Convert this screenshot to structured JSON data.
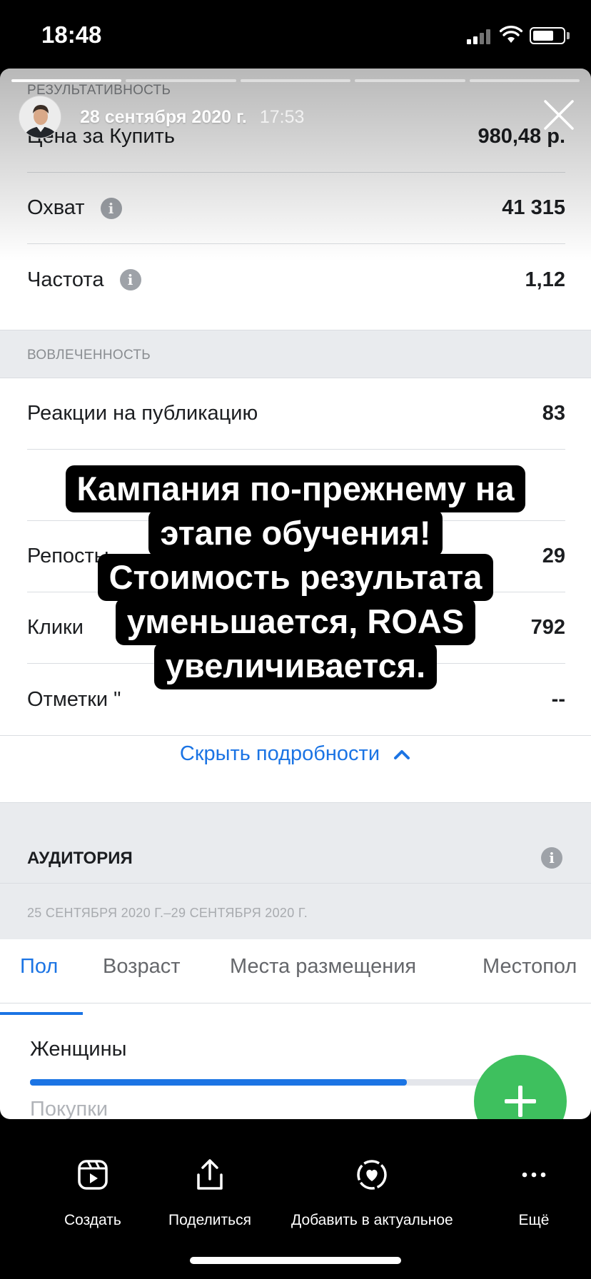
{
  "status_bar": {
    "time": "18:48"
  },
  "story": {
    "date": "28 сентября 2020 г.",
    "time": "17:53"
  },
  "results": {
    "section_label": "РЕЗУЛЬТАТИВНОСТЬ",
    "rows": [
      {
        "label": "Цена за Купить",
        "value": "980,48 р."
      },
      {
        "label": "Охват",
        "value": "41 315"
      },
      {
        "label": "Частота",
        "value": "1,12"
      }
    ]
  },
  "engagement": {
    "section_label": "ВОВЛЕЧЕННОСТЬ",
    "rows": [
      {
        "label": "Реакции на публикацию",
        "value": "83"
      },
      {
        "label": "Репосты",
        "value": "29"
      },
      {
        "label": "Клики",
        "value": "792"
      },
      {
        "label": "Отметки \"",
        "value": "--"
      }
    ]
  },
  "caption": {
    "lines": [
      "Кампания по-прежнему на",
      "этапе обучения!",
      "Стоимость результата",
      "уменьшается, ROAS",
      "увеличивается."
    ]
  },
  "hide_details": {
    "label": "Скрыть подробности",
    "icon": "chevron-up-icon"
  },
  "audience": {
    "title": "АУДИТОРИЯ",
    "date_range": "25 СЕНТЯБРЯ 2020 Г.–29 СЕНТЯБРЯ 2020 Г.",
    "tabs": [
      "Пол",
      "Возраст",
      "Места размещения",
      "Местопол"
    ],
    "active_tab": "Пол",
    "segment_label": "Женщины",
    "segment_share": 0.825,
    "metric_label": "Покупки"
  },
  "colors": {
    "accent": "#1b74e4",
    "fab": "#3ec05e",
    "caption_bg": "#000000"
  },
  "bottom_actions": [
    {
      "label": "Создать",
      "icon": "reels-icon"
    },
    {
      "label": "Поделиться",
      "icon": "share-icon"
    },
    {
      "label": "Добавить в актуальное",
      "icon": "highlight-heart-icon"
    },
    {
      "label": "Ещё",
      "icon": "more-icon"
    }
  ]
}
